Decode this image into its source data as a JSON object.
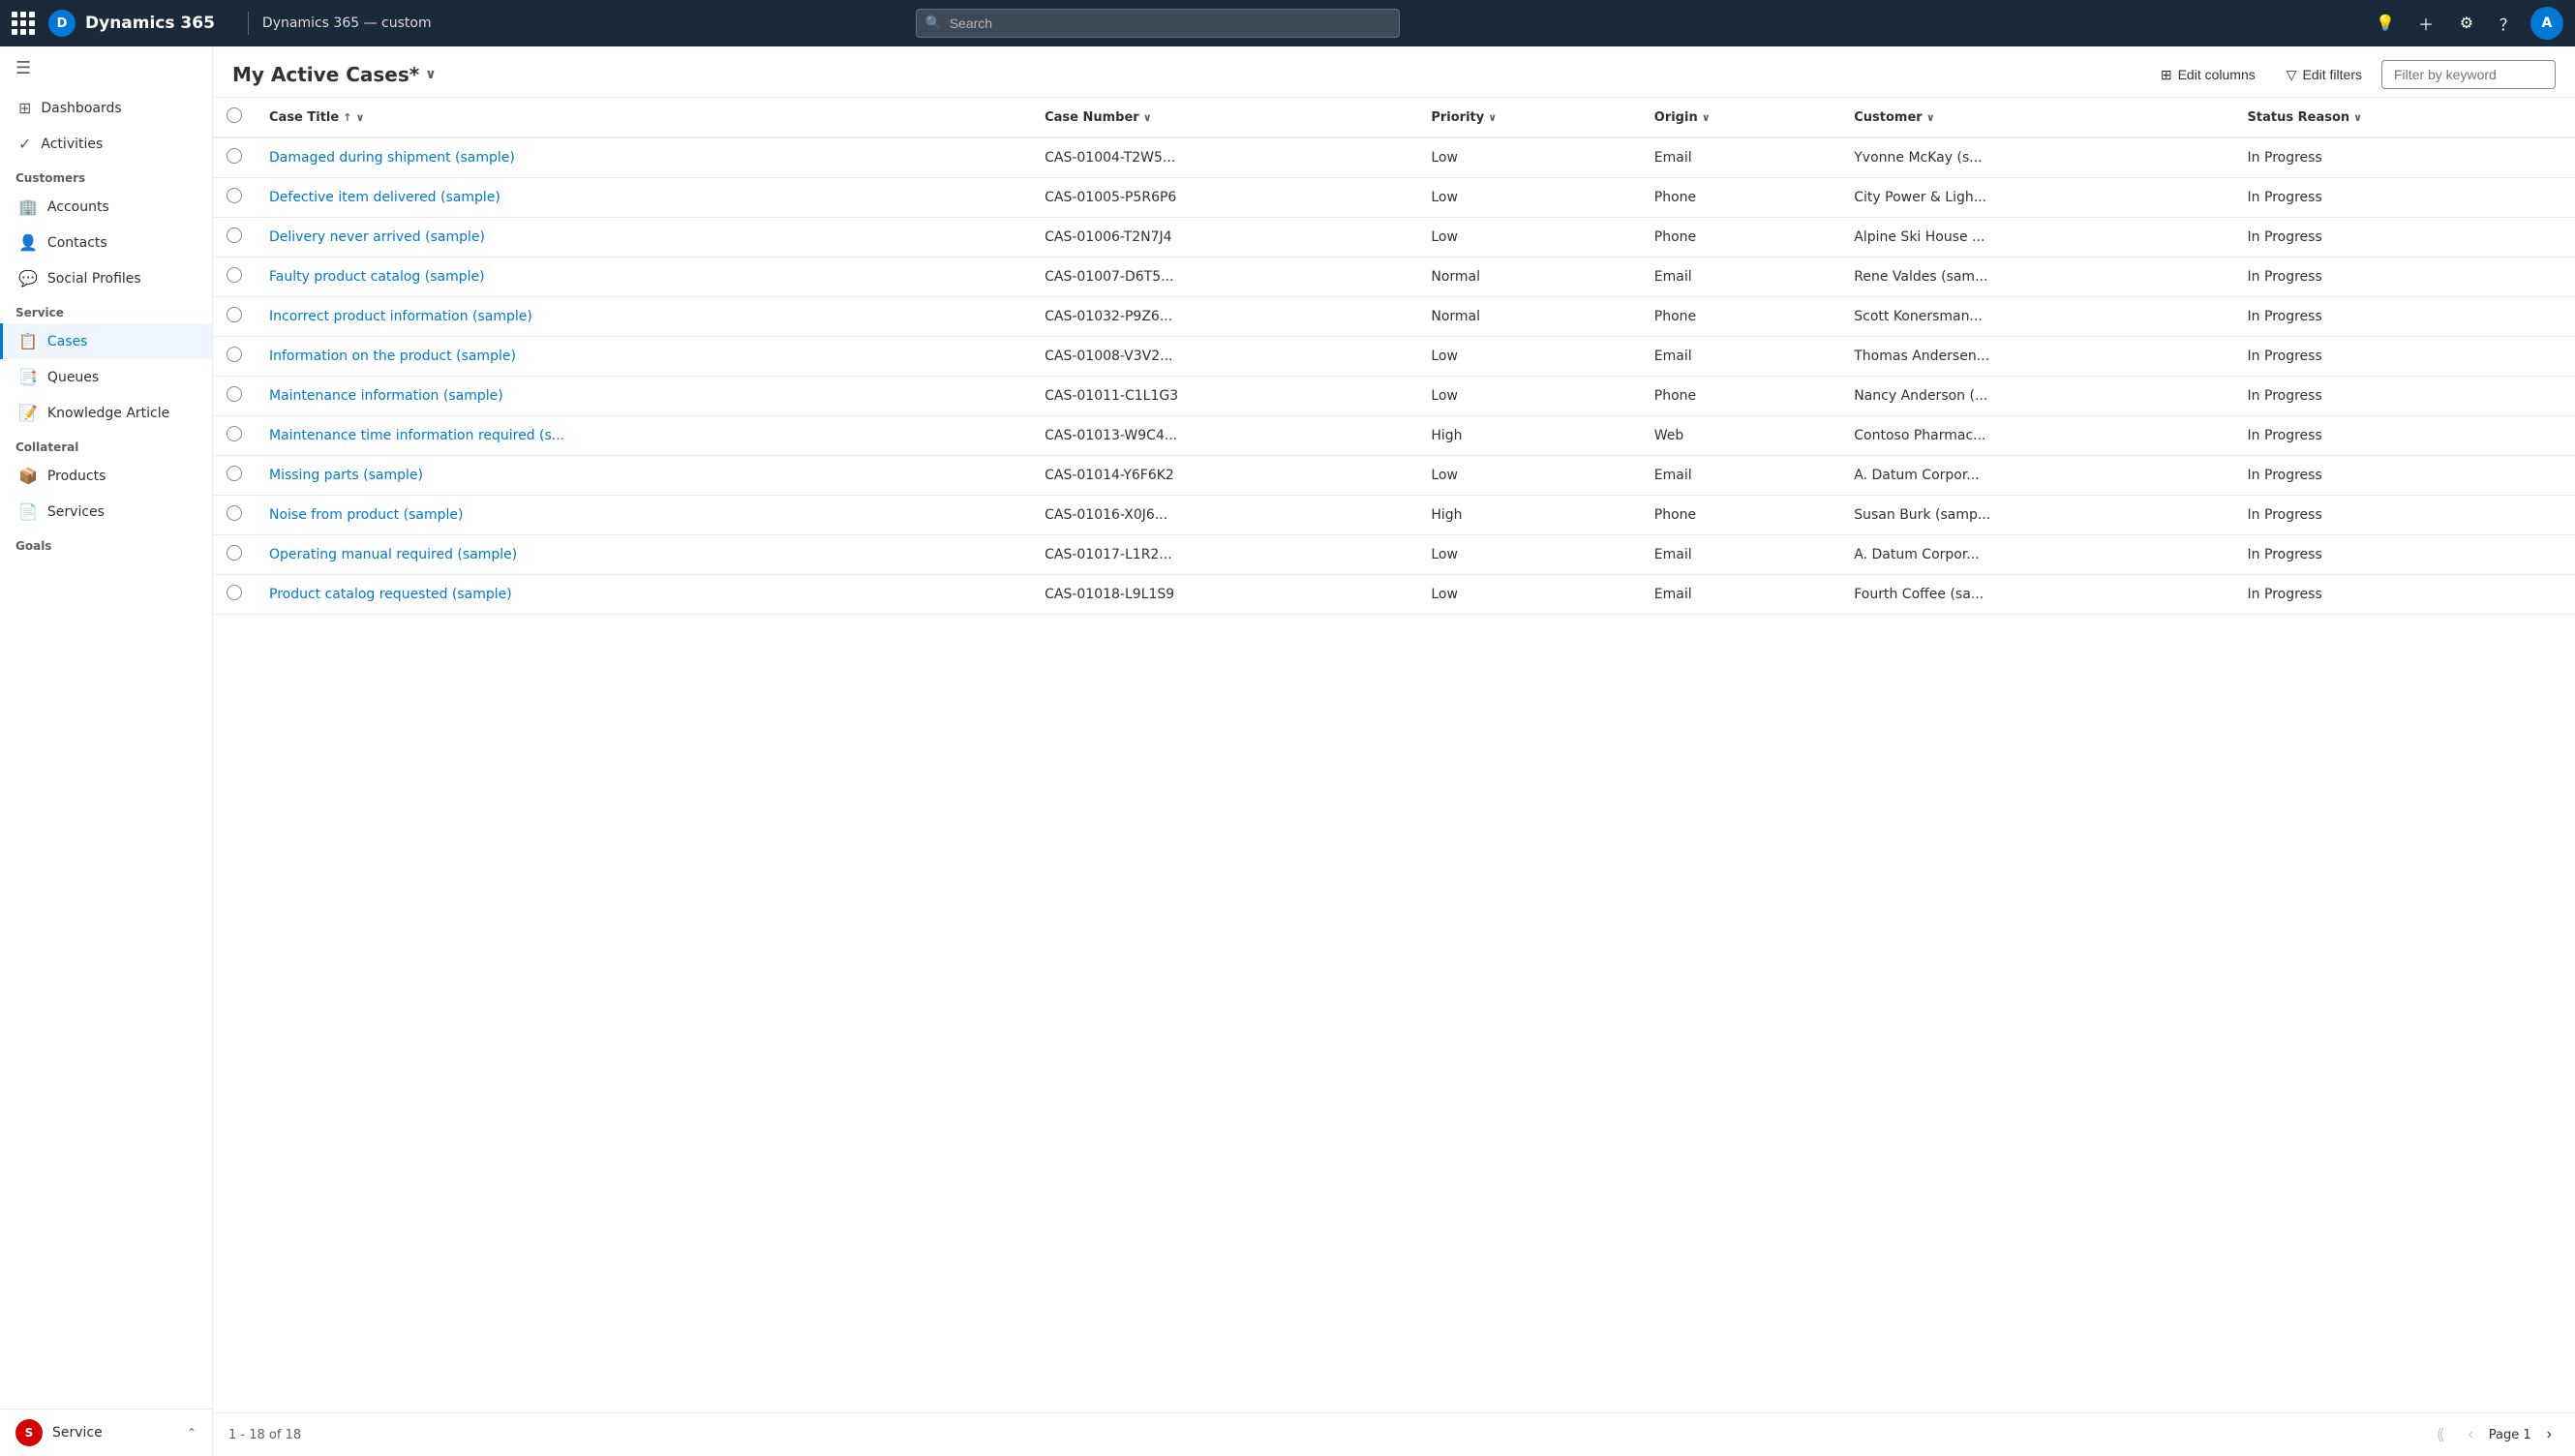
{
  "topnav": {
    "brand": "Dynamics 365",
    "app_name": "Dynamics 365 — custom",
    "search_placeholder": "Search"
  },
  "sidebar": {
    "toggle_icon": "☰",
    "items_standalone": [
      {
        "id": "dashboards",
        "label": "Dashboards",
        "icon": "⊞"
      },
      {
        "id": "activities",
        "label": "Activities",
        "icon": "✓"
      }
    ],
    "sections": [
      {
        "label": "Customers",
        "items": [
          {
            "id": "accounts",
            "label": "Accounts",
            "icon": "🏢"
          },
          {
            "id": "contacts",
            "label": "Contacts",
            "icon": "👤"
          },
          {
            "id": "social-profiles",
            "label": "Social Profiles",
            "icon": "💬"
          }
        ]
      },
      {
        "label": "Service",
        "items": [
          {
            "id": "cases",
            "label": "Cases",
            "icon": "📋",
            "active": true
          },
          {
            "id": "queues",
            "label": "Queues",
            "icon": "📑"
          },
          {
            "id": "knowledge-article",
            "label": "Knowledge Article",
            "icon": "📝"
          }
        ]
      },
      {
        "label": "Collateral",
        "items": [
          {
            "id": "products",
            "label": "Products",
            "icon": "📦"
          },
          {
            "id": "services",
            "label": "Services",
            "icon": "📄"
          }
        ]
      },
      {
        "label": "Goals",
        "items": []
      }
    ],
    "bottom": {
      "label": "Service",
      "initial": "S",
      "chevron": "⌃"
    }
  },
  "content": {
    "view_title": "My Active Cases*",
    "edit_columns_label": "Edit columns",
    "edit_filters_label": "Edit filters",
    "filter_placeholder": "Filter by keyword",
    "columns": [
      {
        "key": "case_title",
        "label": "Case Title",
        "sortable": true,
        "sort": "asc"
      },
      {
        "key": "case_number",
        "label": "Case Number",
        "sortable": true
      },
      {
        "key": "priority",
        "label": "Priority",
        "sortable": true
      },
      {
        "key": "origin",
        "label": "Origin",
        "sortable": true
      },
      {
        "key": "customer",
        "label": "Customer",
        "sortable": true
      },
      {
        "key": "status_reason",
        "label": "Status Reason",
        "sortable": true
      }
    ],
    "rows": [
      {
        "case_title": "Damaged during shipment (sample)",
        "case_number": "CAS-01004-T2W5...",
        "priority": "Low",
        "origin": "Email",
        "customer": "Yvonne McKay (s...",
        "status_reason": "In Progress"
      },
      {
        "case_title": "Defective item delivered (sample)",
        "case_number": "CAS-01005-P5R6P6",
        "priority": "Low",
        "origin": "Phone",
        "customer": "City Power & Ligh...",
        "status_reason": "In Progress"
      },
      {
        "case_title": "Delivery never arrived (sample)",
        "case_number": "CAS-01006-T2N7J4",
        "priority": "Low",
        "origin": "Phone",
        "customer": "Alpine Ski House ...",
        "status_reason": "In Progress"
      },
      {
        "case_title": "Faulty product catalog (sample)",
        "case_number": "CAS-01007-D6T5...",
        "priority": "Normal",
        "origin": "Email",
        "customer": "Rene Valdes (sam...",
        "status_reason": "In Progress"
      },
      {
        "case_title": "Incorrect product information (sample)",
        "case_number": "CAS-01032-P9Z6...",
        "priority": "Normal",
        "origin": "Phone",
        "customer": "Scott Konersman...",
        "status_reason": "In Progress"
      },
      {
        "case_title": "Information on the product (sample)",
        "case_number": "CAS-01008-V3V2...",
        "priority": "Low",
        "origin": "Email",
        "customer": "Thomas Andersen...",
        "status_reason": "In Progress"
      },
      {
        "case_title": "Maintenance information (sample)",
        "case_number": "CAS-01011-C1L1G3",
        "priority": "Low",
        "origin": "Phone",
        "customer": "Nancy Anderson (...",
        "status_reason": "In Progress"
      },
      {
        "case_title": "Maintenance time information required (s...",
        "case_number": "CAS-01013-W9C4...",
        "priority": "High",
        "origin": "Web",
        "customer": "Contoso Pharmac...",
        "status_reason": "In Progress"
      },
      {
        "case_title": "Missing parts (sample)",
        "case_number": "CAS-01014-Y6F6K2",
        "priority": "Low",
        "origin": "Email",
        "customer": "A. Datum Corpor...",
        "status_reason": "In Progress"
      },
      {
        "case_title": "Noise from product (sample)",
        "case_number": "CAS-01016-X0J6...",
        "priority": "High",
        "origin": "Phone",
        "customer": "Susan Burk (samp...",
        "status_reason": "In Progress"
      },
      {
        "case_title": "Operating manual required (sample)",
        "case_number": "CAS-01017-L1R2...",
        "priority": "Low",
        "origin": "Email",
        "customer": "A. Datum Corpor...",
        "status_reason": "In Progress"
      },
      {
        "case_title": "Product catalog requested (sample)",
        "case_number": "CAS-01018-L9L1S9",
        "priority": "Low",
        "origin": "Email",
        "customer": "Fourth Coffee (sa...",
        "status_reason": "In Progress"
      }
    ],
    "pagination": {
      "info": "1 - 18 of 18",
      "page_label": "Page 1"
    }
  }
}
